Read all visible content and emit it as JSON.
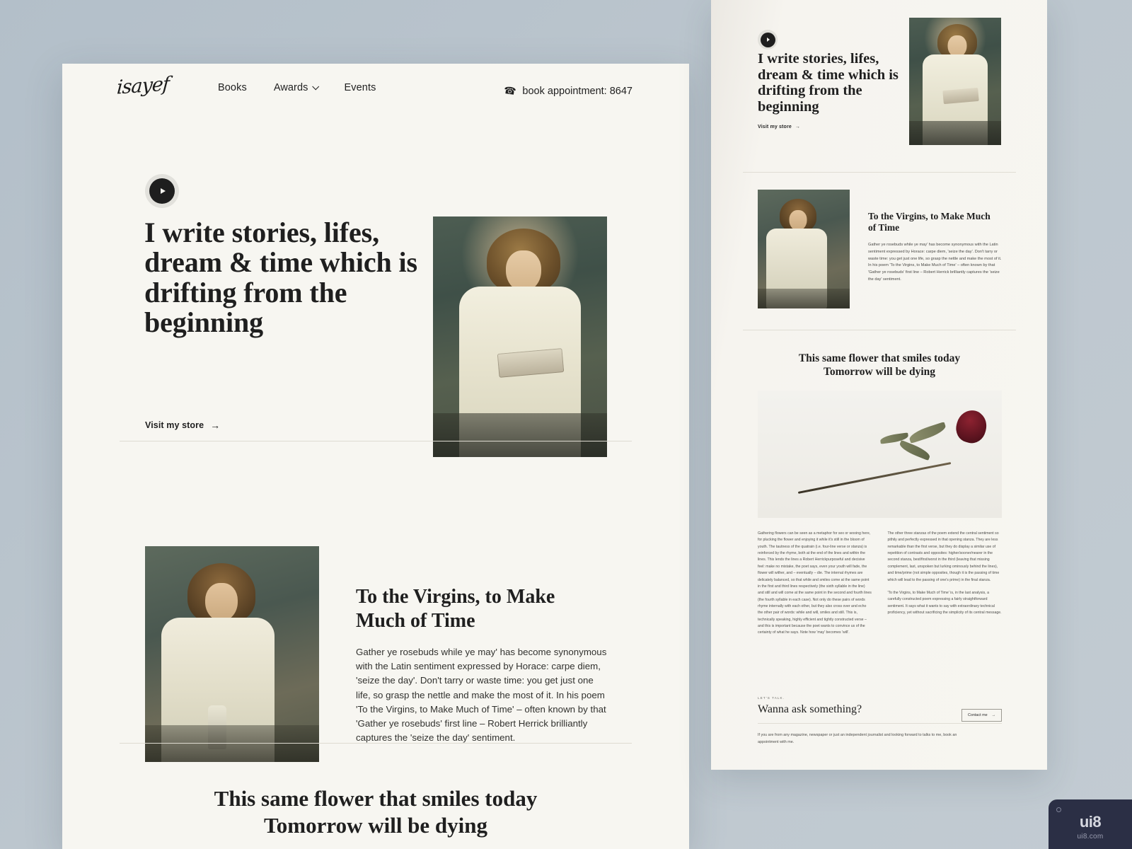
{
  "brand": {
    "logo": "isayef"
  },
  "nav": {
    "items": [
      {
        "label": "Books",
        "has_dropdown": false
      },
      {
        "label": "Awards",
        "has_dropdown": true
      },
      {
        "label": "Events",
        "has_dropdown": false
      }
    ],
    "phone_icon": "phone-icon",
    "phone_label": "book appointment: 8647"
  },
  "hero": {
    "play_icon": "play-icon",
    "heading": "I write stories, lifes, dream & time which is drifting from the beginning",
    "cta_label": "Visit my store",
    "cta_arrow": "arrow-right-icon",
    "image_alt": "portrait-man-holding-book"
  },
  "section_virgins": {
    "image_alt": "portrait-writer-at-desk",
    "heading": "To the Virgins, to Make Much of Time",
    "body": "Gather ye rosebuds while ye may' has become synonymous with the Latin sentiment expressed by Horace: carpe diem, 'seize the day'. Don't tarry or waste time: you get just one life, so grasp the nettle and make the most of it. In his poem 'To the Virgins, to Make Much of Time' – often known by that 'Gather ye rosebuds' first line – Robert Herrick brilliantly captures the 'seize the day' sentiment."
  },
  "section_flower": {
    "heading_line1": "This same flower that smiles today",
    "heading_line2": "Tomorrow will be dying",
    "image_alt": "dried-red-rose-on-white",
    "column_left": [
      "Gathering flowers can be seen as a metaphor for sex or wooing here, for plucking the flower and enjoying it while it's still in the bloom of youth. The tautness of the quatrain (i.e. four-line verse or stanza) is reinforced by the rhyme, both at the end of the lines and within the lines. This lends the lines a Robert Herrickpurposeful and decisive feel: make no mistake, the poet says, even your youth will fade, the flower will wither, and – eventually – die. The internal rhymes are delicately balanced, so that while and smiles come at the same point in the first and third lines respectively (the sixth syllable in the line) and still and will come at the same point in the second and fourth lines (the fourth syllable in each case). Not only do these pairs of words rhyme internally with each other, but they also cross over and echo the other pair of words: while and will, smiles and still. This is, technically speaking, highly efficient and tightly constructed verse – and this is important because the poet wants to convince us of the certainty of what he says. Note how 'may' becomes 'will'."
    ],
    "column_right": [
      "The other three stanzas of the poem extend the central sentiment so pithily and perfectly expressed in that opening stanza. They are less remarkable than the first verse, but they do display a similar use of repetition of contrasts and opposites: higher/sooner/nearer in the second stanza, best/first/worst in the third (leaving that missing complement, last, unspoken but lurking ominously behind the lines), and time/prime (not simple opposites, though it is the passing of time which will lead to the passing of one's prime) in the final stanza.",
      "'To the Virgins, to Make Much of Time' is, in the last analysis, a carefully constructed poem expressing a fairly straightforward sentiment. It says what it wants to say with extraordinary technical proficiency, yet without sacrificing the simplicity of its central message."
    ]
  },
  "contact": {
    "eyebrow": "LET'S TALK.",
    "heading": "Wanna ask something?",
    "button_label": "Contact me",
    "button_arrow": "arrow-right-icon",
    "body": "If you are from any magazine, newspaper or just an independent journalist and looking forward to talks to me, book an appointment with me."
  },
  "watermark": {
    "main": "ui8",
    "sub": "ui8.com"
  },
  "colors": {
    "canvas": "#b7c2cb",
    "page": "#f7f6f1",
    "ink": "#1f1f1f",
    "rule": "#dedbd2"
  }
}
